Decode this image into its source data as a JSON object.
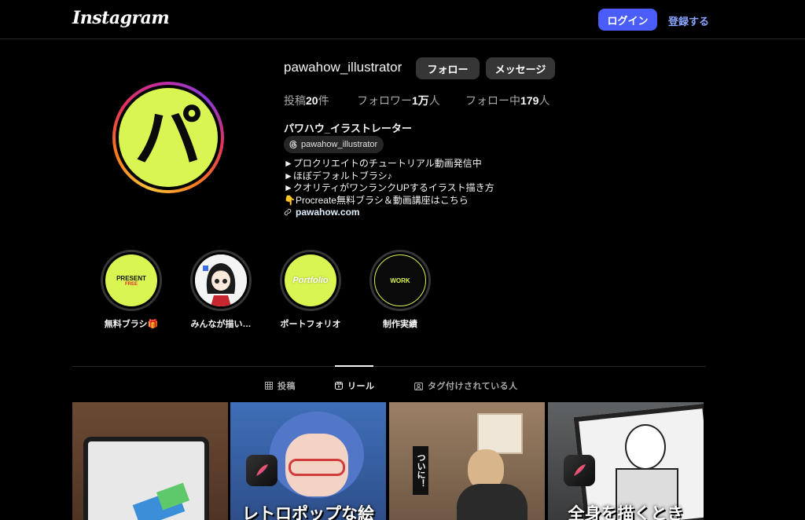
{
  "header": {
    "logo": "Instagram",
    "login_label": "ログイン",
    "signup_label": "登録する"
  },
  "profile": {
    "avatar_char": "パ",
    "username": "pawahow_illustrator",
    "follow_label": "フォロー",
    "message_label": "メッセージ",
    "posts_label": "投稿",
    "posts_count": "20",
    "posts_unit": "件",
    "followers_label": "フォロワー",
    "followers_count": "1万",
    "followers_unit": "人",
    "following_label": "フォロー中",
    "following_count": "179",
    "following_unit": "人",
    "full_name": "パワハウ_イラストレーター",
    "threads_handle": "pawahow_illustrator",
    "bio": [
      "►プロクリエイトのチュートリアル動画発信中",
      "►ほぼデフォルトブラシ♪",
      "►クオリティがワンランクUPするイラスト描き方",
      "👇Procreate無料ブラシ＆動画講座はこちら"
    ],
    "link": "pawahow.com"
  },
  "highlights": [
    {
      "label": "無料ブラシ🎁",
      "title": "PRESENT",
      "sub": "FREE"
    },
    {
      "label": "みんなが描い…",
      "title": "",
      "sub": ""
    },
    {
      "label": "ポートフォリオ",
      "title": "Portfolio",
      "sub": ""
    },
    {
      "label": "制作実績",
      "title": "WORK",
      "sub": ""
    }
  ],
  "tabs": [
    {
      "label": "投稿",
      "icon": "grid-icon",
      "active": false
    },
    {
      "label": "リール",
      "icon": "reels-icon",
      "active": true
    },
    {
      "label": "タグ付けされている人",
      "icon": "tagged-icon",
      "active": false
    }
  ],
  "reels": [
    {
      "caption": ""
    },
    {
      "caption": "レトロポップな絵"
    },
    {
      "caption": "ついに！"
    },
    {
      "caption": "全身を描くとき"
    }
  ],
  "colors": {
    "accent": "#4a5df9",
    "avatar_bg": "#d9f552",
    "background": "#000000"
  }
}
